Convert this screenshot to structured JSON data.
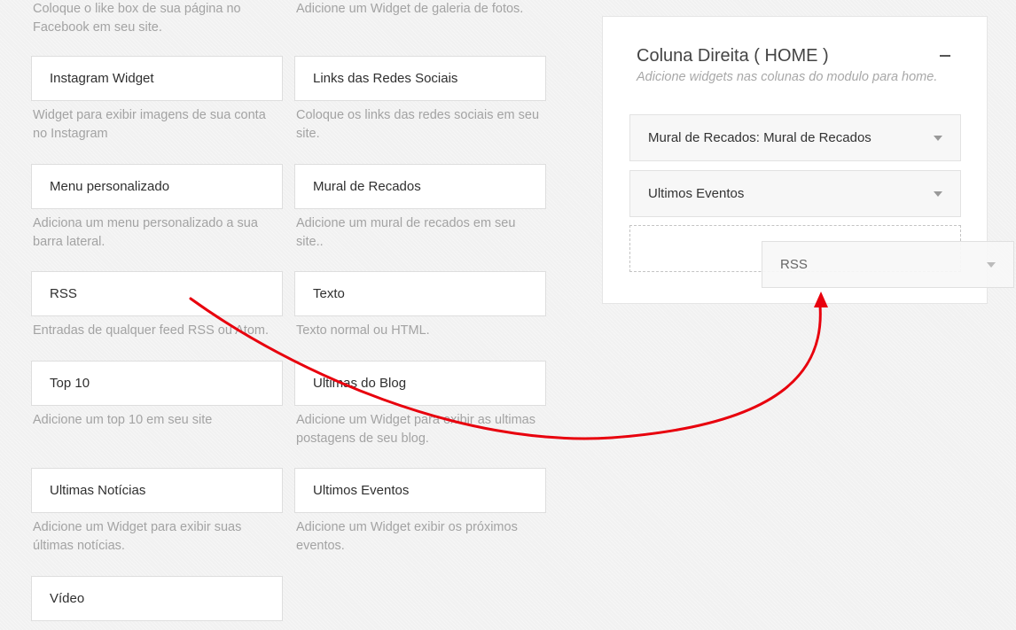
{
  "widgets_col1": [
    {
      "label": null,
      "desc": "Coloque o like box de sua página no Facebook em seu site."
    },
    {
      "label": "Instagram Widget",
      "desc": "Widget para exibir imagens de sua conta no Instagram"
    },
    {
      "label": "Menu personalizado",
      "desc": "Adiciona um menu personalizado a sua barra lateral."
    },
    {
      "label": "RSS",
      "desc": "Entradas de qualquer feed RSS ou Atom."
    },
    {
      "label": "Top 10",
      "desc": "Adicione um top 10 em seu site"
    },
    {
      "label": "Ultimas Notícias",
      "desc": "Adicione um Widget para exibir suas últimas notícias."
    },
    {
      "label": "Vídeo",
      "desc": null
    }
  ],
  "widgets_col2": [
    {
      "label": null,
      "desc": "Adicione um Widget de galeria de fotos."
    },
    {
      "label": "Links das Redes Sociais",
      "desc": "Coloque os links das redes sociais em seu site."
    },
    {
      "label": "Mural de Recados",
      "desc": "Adicione um mural de recados em seu site.."
    },
    {
      "label": "Texto",
      "desc": "Texto normal ou HTML."
    },
    {
      "label": "Ultimas do Blog",
      "desc": "Adicione um Widget para exibir as ultimas postagens de seu blog."
    },
    {
      "label": "Ultimos Eventos",
      "desc": "Adicione um Widget exibir os próximos eventos."
    }
  ],
  "sidebar": {
    "title": "Coluna Direita ( HOME )",
    "subtitle": "Adicione widgets nas colunas do modulo para home.",
    "items": [
      {
        "label": "Mural de Recados: Mural de Recados"
      },
      {
        "label": "Ultimos Eventos"
      }
    ]
  },
  "dragging": {
    "label": "RSS"
  },
  "colors": {
    "arrow": "#e8000d",
    "background": "#f1f1f1"
  }
}
